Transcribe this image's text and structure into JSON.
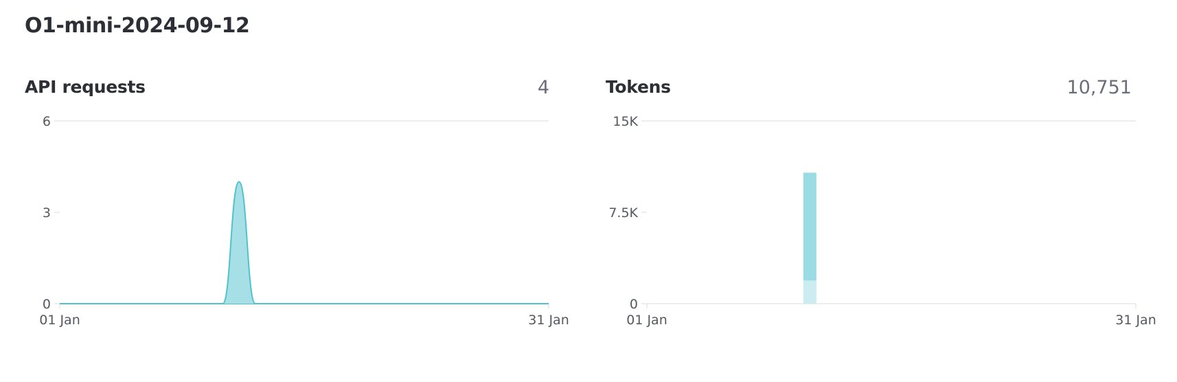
{
  "page": {
    "title": "O1-mini-2024-09-12"
  },
  "colors": {
    "line": "#4fc3cc",
    "fill": "#a7dfe6",
    "bar_main": "#9bdbe3",
    "bar_light": "#cbecf0",
    "grid": "#e6e7ea",
    "text": "#2d2f36",
    "muted": "#6b6e78"
  },
  "panels": [
    {
      "title": "API requests",
      "total": "4"
    },
    {
      "title": "Tokens",
      "total": "10,751"
    }
  ],
  "chart_data": [
    {
      "type": "area",
      "title": "API requests",
      "xlabel": "",
      "ylabel": "",
      "x_range": [
        1,
        31
      ],
      "x_ticks": [
        "01 Jan",
        "31 Jan"
      ],
      "ylim": [
        0,
        6
      ],
      "y_ticks": [
        "6",
        "3",
        "0"
      ],
      "grid": "top-line",
      "series": [
        {
          "x": [
            1,
            11,
            12,
            13,
            31
          ],
          "values": [
            0,
            0,
            4,
            0,
            0
          ]
        }
      ]
    },
    {
      "type": "bar",
      "title": "Tokens",
      "xlabel": "",
      "ylabel": "",
      "x_range": [
        1,
        31
      ],
      "x_ticks": [
        "01 Jan",
        "31 Jan"
      ],
      "ylim": [
        0,
        15000
      ],
      "y_ticks": [
        "15K",
        "7.5K",
        "0"
      ],
      "grid": "top-line",
      "stacked": true,
      "series": [
        {
          "x": [
            11
          ],
          "values": [
            1900
          ]
        },
        {
          "x": [
            11
          ],
          "values": [
            8851
          ]
        }
      ]
    }
  ]
}
